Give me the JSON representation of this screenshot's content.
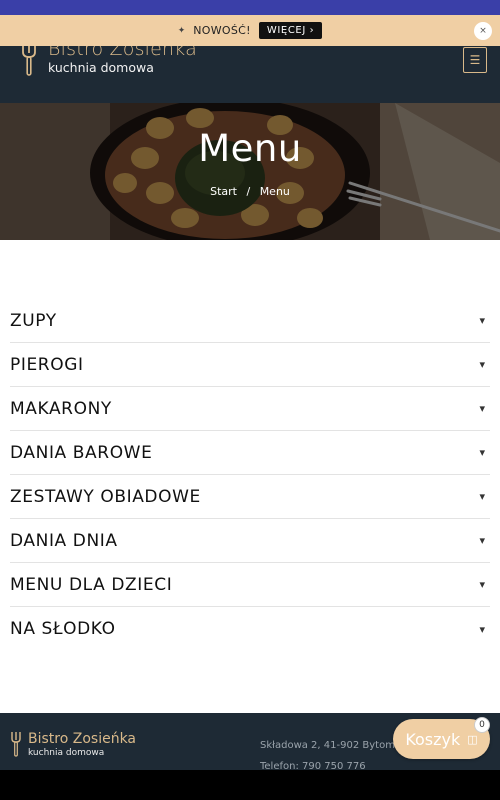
{
  "colors": {
    "accent": "#d9b98a",
    "header_bg": "#1e2a35",
    "promo_bg": "#f0cfa4",
    "cart_bg": "#f0cfa4"
  },
  "promo": {
    "icon": "sparkle-icon",
    "label": "NOWOŚĆ!",
    "button": "WIĘCEJ",
    "button_icon": "arrow-right-icon",
    "close_icon": "close-icon"
  },
  "header": {
    "logo_name": "Bistro Zosieńka",
    "logo_sub": "kuchnia domowa",
    "menu_icon": "hamburger-icon"
  },
  "hero": {
    "title": "Menu",
    "breadcrumb": [
      "Start",
      "/",
      "Menu"
    ]
  },
  "categories": [
    {
      "label": "ZUPY",
      "icon": "chevron-down-icon"
    },
    {
      "label": "PIEROGI",
      "icon": "chevron-down-icon"
    },
    {
      "label": "MAKARONY",
      "icon": "chevron-down-icon"
    },
    {
      "label": "DANIA BAROWE",
      "icon": "chevron-down-icon"
    },
    {
      "label": "ZESTAWY OBIADOWE",
      "icon": "chevron-down-icon"
    },
    {
      "label": "DANIA DNIA",
      "icon": "chevron-down-icon"
    },
    {
      "label": "MENU DLA DZIECI",
      "icon": "chevron-down-icon"
    },
    {
      "label": "NA SŁODKO",
      "icon": "chevron-down-icon"
    }
  ],
  "footer": {
    "logo_name": "Bistro Zosieńka",
    "logo_sub": "kuchnia domowa",
    "address": "Składowa 2, 41-902 Bytom",
    "phone": "Telefon: 790 750 776"
  },
  "cart": {
    "label": "Koszyk",
    "icon": "cart-icon",
    "count": "0"
  }
}
